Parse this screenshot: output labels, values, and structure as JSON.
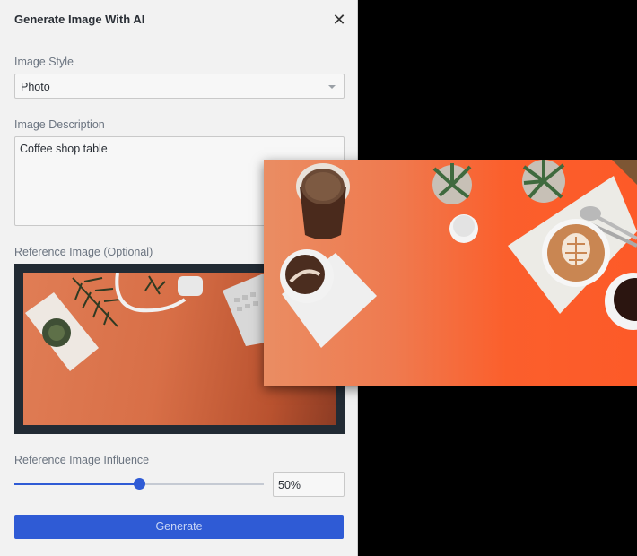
{
  "dialog": {
    "title": "Generate Image With AI",
    "close_symbol": "✕"
  },
  "style_field": {
    "label": "Image Style",
    "value": "Photo"
  },
  "description_field": {
    "label": "Image Description",
    "value": "Coffee shop table"
  },
  "reference_field": {
    "label": "Reference Image (Optional)"
  },
  "influence": {
    "label": "Reference Image Influence",
    "value": 0.5,
    "value_text": "50%"
  },
  "generate_button": {
    "label": "Generate"
  },
  "colors": {
    "accent": "#2f5bd5",
    "result_background": "#fb5f2c",
    "reference_background": "#d86f47"
  },
  "icons": {
    "close": "close-icon",
    "dropdown": "chevron-down-icon"
  }
}
